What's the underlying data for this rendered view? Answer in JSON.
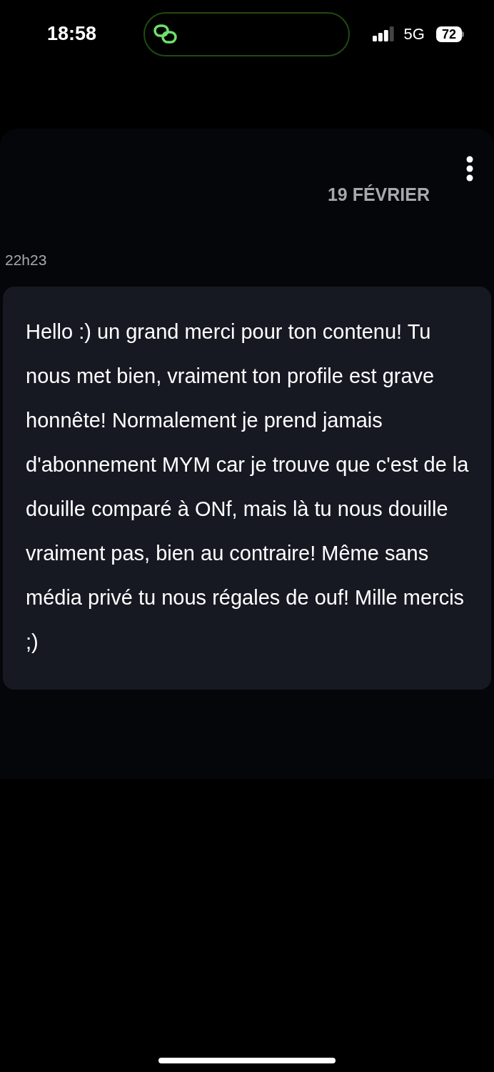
{
  "status_bar": {
    "time": "18:58",
    "network": "5G",
    "battery": "72"
  },
  "chat": {
    "date": "19 FÉVRIER",
    "messages": [
      {
        "time": "22h23",
        "text": "Hello :) un grand merci pour ton contenu! Tu nous met bien, vraiment ton profile est grave honnête! Normalement je prend jamais d'abonnement MYM car je trouve que c'est de la douille comparé à ONf, mais là tu nous douille vraiment pas, bien au contraire! Même sans média privé tu nous régales de ouf! Mille mercis ;)"
      }
    ]
  }
}
